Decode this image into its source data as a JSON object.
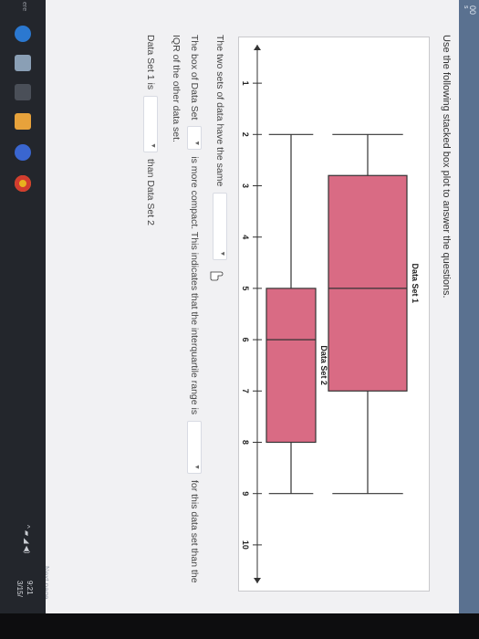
{
  "page": {
    "topbar_number": "00",
    "topbar_sub": "s",
    "instruction": "Use the following stacked box plot to answer the questions."
  },
  "chart_data": {
    "type": "box",
    "orientation": "horizontal",
    "x_ticks": [
      "1",
      "2",
      "3",
      "4",
      "5",
      "6",
      "7",
      "8",
      "9",
      "10"
    ],
    "xlim": [
      0.5,
      10.5
    ],
    "box_color": "#d96b84",
    "series": [
      {
        "name": "Data Set 1",
        "min": 2,
        "q1": 2.8,
        "median": 5,
        "q3": 7,
        "max": 9
      },
      {
        "name": "Data Set 2",
        "min": 2,
        "q1": 5,
        "median": 6,
        "q3": 8,
        "max": 9
      }
    ]
  },
  "questions": {
    "q1_text": "The two sets of data have the same",
    "q2_prefix": "The box of Data Set",
    "q2_middle": "is more compact. This indicates that the interquartile range is",
    "q2_suffix": "for this data set than the",
    "q2_line2": "IQR of the other data set.",
    "q3_prefix": "Data Set 1 is",
    "q3_suffix": "than Data Set 2"
  },
  "footer": {
    "next_page": "Next page"
  },
  "taskbar": {
    "search_label": "ere",
    "clock_time": "9:21",
    "clock_date": "3/15/"
  }
}
